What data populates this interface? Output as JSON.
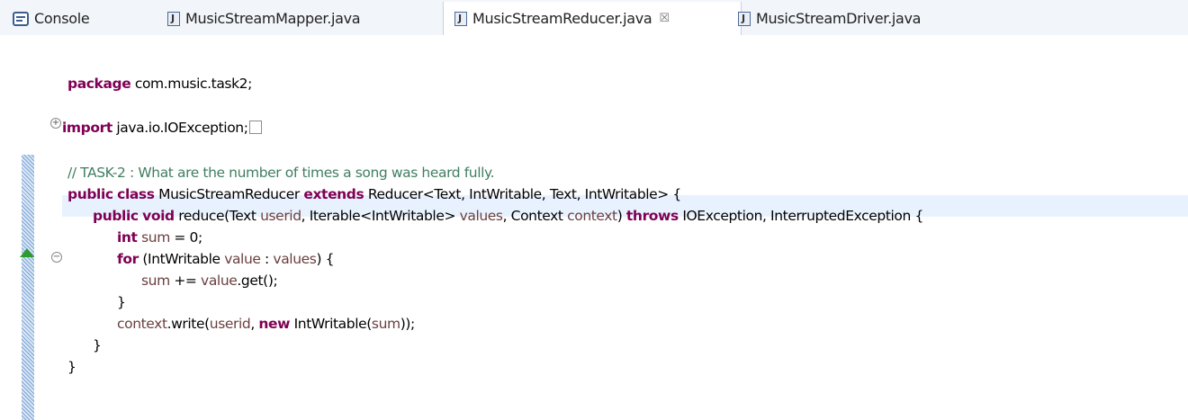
{
  "tabs": [
    {
      "label": "Console",
      "icon": "console-icon",
      "active": false
    },
    {
      "label": "MusicStreamMapper.java",
      "icon": "java-file-icon",
      "active": false
    },
    {
      "label": "MusicStreamReducer.java",
      "icon": "java-file-icon",
      "active": true,
      "close": "☒"
    },
    {
      "label": "MusicStreamDriver.java",
      "icon": "java-file-icon",
      "active": false
    }
  ],
  "code": {
    "l1": {
      "kw": "package",
      "rest": " com.music.task2;"
    },
    "l2": {
      "kw": "import",
      "rest": " java.io.IOException;"
    },
    "l3": {
      "comment": "// TASK-2 : What are the number of times a song was heard fully."
    },
    "l4": {
      "kw1": "public",
      "kw2": "class",
      "a": " MusicStreamReducer ",
      "kw3": "extends",
      "b": " Reducer<Text, IntWritable, Text, IntWritable> {"
    },
    "l5": {
      "kw1": "public",
      "kw2": "void",
      "a": " reduce(Text ",
      "v1": "userid",
      "b": ", Iterable<IntWritable> ",
      "v2": "values",
      "c": ", Context ",
      "v3": "context",
      "d": ") ",
      "kw3": "throws",
      "e": " IOException, InterruptedException {"
    },
    "l6": {
      "kw": "int",
      "v": " sum",
      "rest": " = 0;"
    },
    "l7": {
      "kw": "for",
      "a": " (IntWritable ",
      "v1": "value",
      "b": " : ",
      "v2": "values",
      "c": ") {"
    },
    "l8": {
      "v1": "sum",
      "a": " += ",
      "v2": "value",
      "b": ".get();"
    },
    "l9": {
      "text": "}"
    },
    "l10": {
      "v1": "context",
      "a": ".write(",
      "v2": "userid",
      "b": ", ",
      "kw": "new",
      "c": " IntWritable(",
      "v3": "sum",
      "d": "));"
    },
    "l11": {
      "text": "}"
    },
    "l12": {
      "text": "}"
    }
  },
  "colors": {
    "keyword": "#7f0055",
    "variable": "#6a3e3e",
    "comment": "#3f7f5f",
    "line_highlight": "#e8f2fe"
  }
}
